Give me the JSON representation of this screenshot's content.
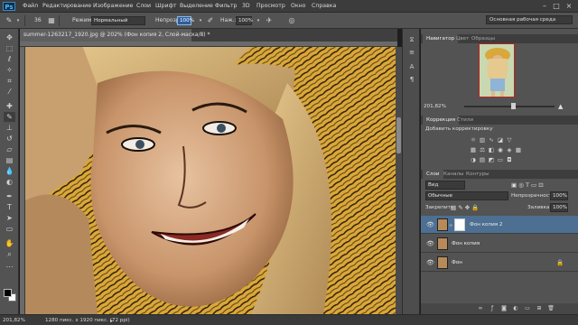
{
  "app": {
    "logo": "Ps"
  },
  "menu": [
    "Файл",
    "Редактирование",
    "Изображение",
    "Слои",
    "Шрифт",
    "Выделение",
    "Фильтр",
    "3D",
    "Просмотр",
    "Окно",
    "Справка"
  ],
  "options": {
    "brush_size": "36",
    "mode_label": "Режим:",
    "mode_value": "Нормальный",
    "opacity_label": "Непрозр.:",
    "opacity_value": "100%",
    "flow_label": "Наж.:",
    "flow_value": "100%"
  },
  "workspace": "Основная рабочая среда",
  "document": {
    "tab_title": "summer-1263217_1920.jpg @ 202% (Фон копия 2, Слой-маска/8) *",
    "zoom": "201,82%",
    "info": "1280 пикс. x 1920 пикс. (72 ppi)"
  },
  "navigator": {
    "tabs": [
      "Навигатор",
      "Цвет",
      "Образцы"
    ],
    "zoom": "201,82%"
  },
  "adjustments": {
    "tabs": [
      "Коррекция",
      "Стили"
    ],
    "add_label": "Добавить корректировку"
  },
  "layers_panel": {
    "tabs": [
      "Слои",
      "Каналы",
      "Контуры"
    ],
    "filter_kind": "Вид",
    "blend_mode": "Обычные",
    "opacity_label": "Непрозрачность:",
    "opacity_value": "100%",
    "lock_label": "Закрепить:",
    "fill_label": "Заливка:",
    "fill_value": "100%",
    "layers": [
      {
        "name": "Фон копия 2",
        "selected": true,
        "mask": true
      },
      {
        "name": "Фон копия",
        "selected": false,
        "mask": false
      },
      {
        "name": "Фон",
        "selected": false,
        "mask": false,
        "locked": true
      }
    ]
  },
  "colors": {
    "menubar": "#3c3c3c",
    "panel": "#535353",
    "selected_layer": "#4d6f92",
    "accent": "#2b5e9e"
  },
  "icons": {
    "tools": [
      "move-icon",
      "marquee-icon",
      "lasso-icon",
      "quick-select-icon",
      "crop-icon",
      "eyedropper-icon",
      "healing-icon",
      "brush-icon",
      "stamp-icon",
      "history-brush-icon",
      "eraser-icon",
      "gradient-icon",
      "blur-icon",
      "dodge-icon",
      "pen-icon",
      "type-icon",
      "path-select-icon",
      "shape-icon",
      "hand-icon",
      "zoom-icon"
    ]
  }
}
